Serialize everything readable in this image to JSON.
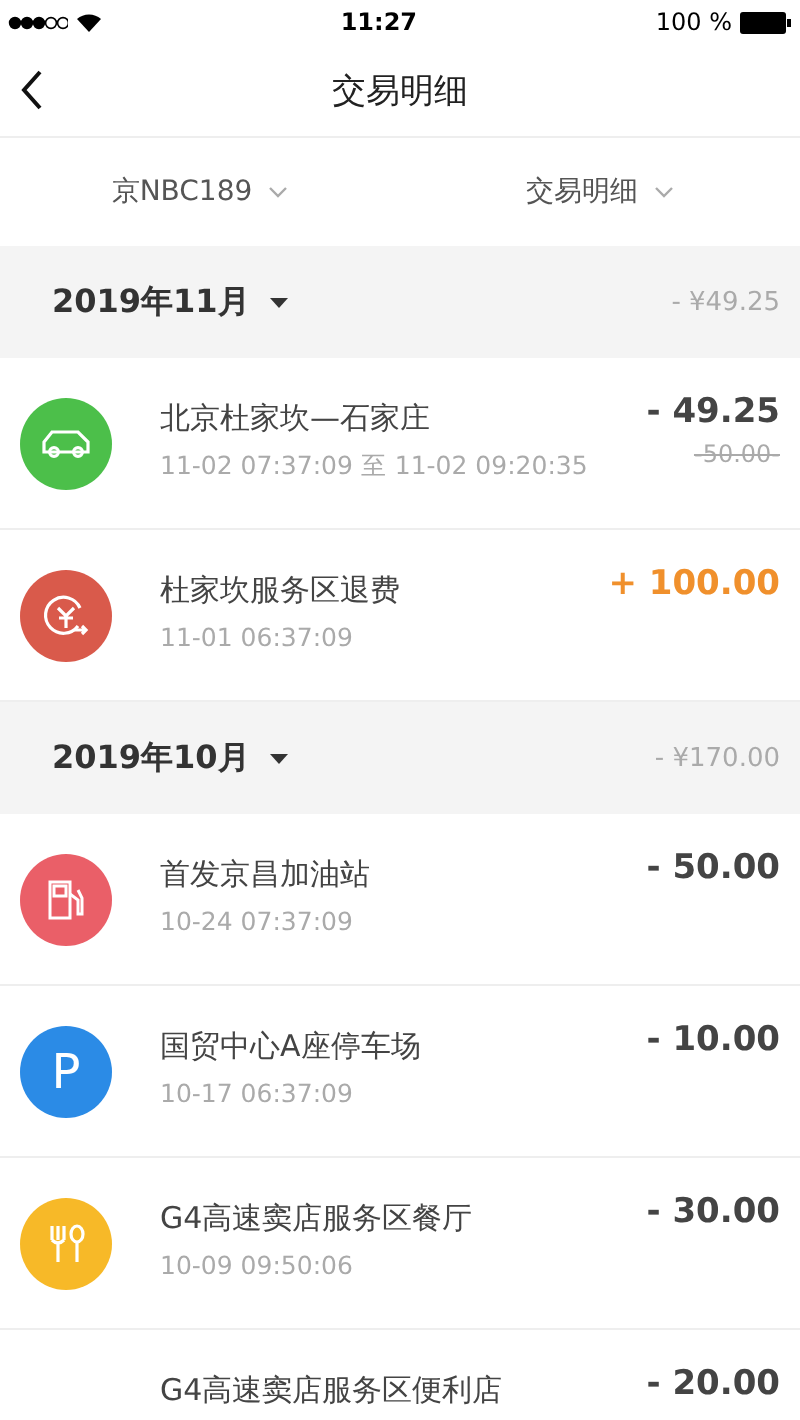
{
  "status_bar": {
    "time": "11:27",
    "battery": "100 %"
  },
  "nav": {
    "title": "交易明细"
  },
  "filters": [
    {
      "label": "京NBC189"
    },
    {
      "label": "交易明细"
    }
  ],
  "months": [
    {
      "title": "2019年11月",
      "total": "- ¥49.25",
      "items": [
        {
          "kind": "car",
          "color": "#4cbf4a",
          "name": "北京杜家坎—石家庄",
          "time": "11-02 07:37:09 至 11-02 09:20:35",
          "amount": "- 49.25",
          "credit": false,
          "original": "-50.00-"
        },
        {
          "kind": "refund",
          "color": "#d95a4b",
          "name": "杜家坎服务区退费",
          "time": "11-01 06:37:09",
          "amount": "+ 100.00",
          "credit": true
        }
      ]
    },
    {
      "title": "2019年10月",
      "total": "- ¥170.00",
      "items": [
        {
          "kind": "fuel",
          "color": "#ea5f68",
          "name": "首发京昌加油站",
          "time": "10-24 07:37:09",
          "amount": "- 50.00",
          "credit": false
        },
        {
          "kind": "parking",
          "color": "#2b8be6",
          "name": "国贸中心A座停车场",
          "time": "10-17 06:37:09",
          "amount": "- 10.00",
          "credit": false,
          "icon_text": "P"
        },
        {
          "kind": "food",
          "color": "#f7b928",
          "name": "G4高速窦店服务区餐厅",
          "time": "10-09 09:50:06",
          "amount": "- 30.00",
          "credit": false
        },
        {
          "name": "G4高速窦店服务区便利店",
          "amount": "- 20.00",
          "credit": false
        }
      ]
    }
  ]
}
